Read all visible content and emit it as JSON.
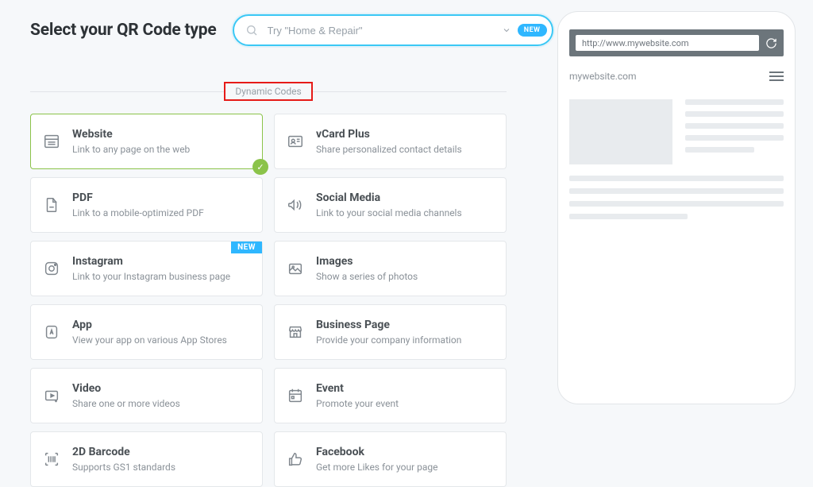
{
  "header": {
    "title": "Select your QR Code type",
    "search_placeholder": "Try \"Home & Repair\"",
    "new_pill": "NEW"
  },
  "section_label": "Dynamic Codes",
  "cards": [
    {
      "id": "website",
      "title": "Website",
      "desc": "Link to any page on the web",
      "icon": "website",
      "selected": true
    },
    {
      "id": "vcard",
      "title": "vCard Plus",
      "desc": "Share personalized contact details",
      "icon": "vcard"
    },
    {
      "id": "pdf",
      "title": "PDF",
      "desc": "Link to a mobile-optimized PDF",
      "icon": "pdf"
    },
    {
      "id": "social",
      "title": "Social Media",
      "desc": "Link to your social media channels",
      "icon": "megaphone"
    },
    {
      "id": "instagram",
      "title": "Instagram",
      "desc": "Link to your Instagram business page",
      "icon": "instagram",
      "new": true
    },
    {
      "id": "images",
      "title": "Images",
      "desc": "Show a series of photos",
      "icon": "images"
    },
    {
      "id": "app",
      "title": "App",
      "desc": "View your app on various App Stores",
      "icon": "app"
    },
    {
      "id": "business",
      "title": "Business Page",
      "desc": "Provide your company information",
      "icon": "store"
    },
    {
      "id": "video",
      "title": "Video",
      "desc": "Share one or more videos",
      "icon": "video"
    },
    {
      "id": "event",
      "title": "Event",
      "desc": "Promote your event",
      "icon": "event"
    },
    {
      "id": "barcode",
      "title": "2D Barcode",
      "desc": "Supports GS1 standards",
      "icon": "barcode"
    },
    {
      "id": "facebook",
      "title": "Facebook",
      "desc": "Get more Likes for your page",
      "icon": "thumbsup"
    }
  ],
  "badge_new": "NEW",
  "preview": {
    "url": "http://www.mywebsite.com",
    "site_name": "mywebsite.com"
  }
}
